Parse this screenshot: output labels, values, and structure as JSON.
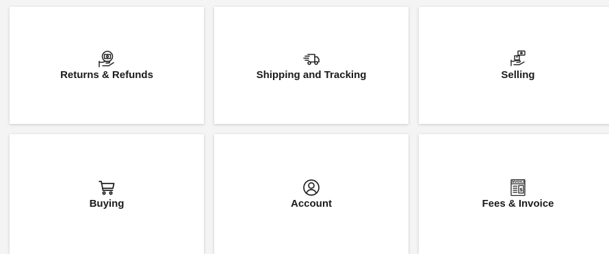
{
  "help_topics": [
    {
      "label": "Returns & Refunds",
      "icon": "refund-icon"
    },
    {
      "label": "Shipping and Tracking",
      "icon": "delivery-truck-icon"
    },
    {
      "label": "Selling",
      "icon": "selling-icon"
    },
    {
      "label": "Buying",
      "icon": "shopping-cart-icon"
    },
    {
      "label": "Account",
      "icon": "user-account-icon"
    },
    {
      "label": "Fees & Invoice",
      "icon": "invoice-icon",
      "icon_text": "INVOICE"
    }
  ],
  "colors": {
    "background": "#f4f4f4",
    "card": "#ffffff",
    "text": "#1a1a1a",
    "icon": "#222222"
  }
}
